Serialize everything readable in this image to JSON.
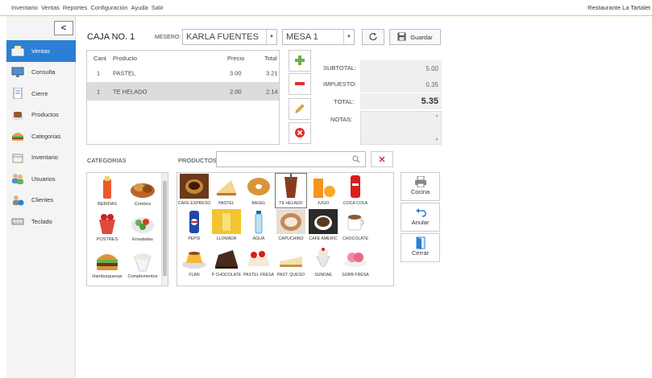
{
  "menu": {
    "items": [
      "Inventario",
      "Ventas",
      "Reportes",
      "Configuración",
      "Ayuda",
      "Salir"
    ],
    "restaurant": "Restaurante La Tartalet"
  },
  "sidebar": {
    "collapse_glyph": "<",
    "items": [
      {
        "label": "Ventas",
        "icon": "register-icon",
        "active": true
      },
      {
        "label": "Consulta",
        "icon": "monitor-icon",
        "active": false
      },
      {
        "label": "Cierre",
        "icon": "document-icon",
        "active": false
      },
      {
        "label": "Productos",
        "icon": "cup-icon",
        "active": false
      },
      {
        "label": "Categorias",
        "icon": "burger-icon",
        "active": false
      },
      {
        "label": "Inventario",
        "icon": "box-icon",
        "active": false
      },
      {
        "label": "Usuarios",
        "icon": "users-icon",
        "active": false
      },
      {
        "label": "Clientes",
        "icon": "client-icon",
        "active": false
      },
      {
        "label": "Teclado",
        "icon": "keyboard-icon",
        "active": false
      }
    ]
  },
  "header": {
    "caja": "CAJA NO. 1",
    "mesero_label": "MESERO:",
    "mesero_value": "KARLA FUENTES",
    "mesa_value": "MESA 1",
    "guardar": "Guardar"
  },
  "order": {
    "columns": {
      "cant": "Cant",
      "producto": "Producto",
      "precio": "Precio",
      "total": "Total"
    },
    "rows": [
      {
        "cant": "1",
        "producto": "PASTEL",
        "precio": "3.00",
        "total": "3.21",
        "selected": false
      },
      {
        "cant": "1",
        "producto": "TE HELADO",
        "precio": "2.00",
        "total": "2.14",
        "selected": true
      }
    ]
  },
  "totals": {
    "subtotal_label": "SUBTOTAL:",
    "subtotal": "5.00",
    "impuesto_label": "IMPUESTO:",
    "impuesto": "0.35",
    "total_label": "TOTAL:",
    "total": "5.35",
    "notas_label": "NOTAS:"
  },
  "categories_label": "CATEGORIAS",
  "products_label": "PRODUCTOS",
  "categories": [
    "BEBIDAS",
    "Combos",
    "POSTRES",
    "Ensaladas",
    "Hamburguesas",
    "Complementos"
  ],
  "products": [
    "CAFE EXPRESO",
    "PASTEL",
    "BAGEL",
    "TE HELADO",
    "JUGO",
    "COCA COLA",
    "PEPSI",
    "LLOMADA",
    "AGUA",
    "CAPUCHINO",
    "CAFE AMERIC",
    "CHOCOLATE",
    "FLAN",
    "P CHOCOLATE",
    "PASTEL FRESA",
    "PAST. QUESO",
    "SUNDAE",
    "SORB FRESA"
  ],
  "side_buttons": {
    "cocina": "Cocina",
    "anular": "Anular",
    "cerrar": "Cerrar"
  },
  "colors": {
    "accent": "#2b7fd4",
    "add": "#6ab04c",
    "remove": "#e03030"
  }
}
